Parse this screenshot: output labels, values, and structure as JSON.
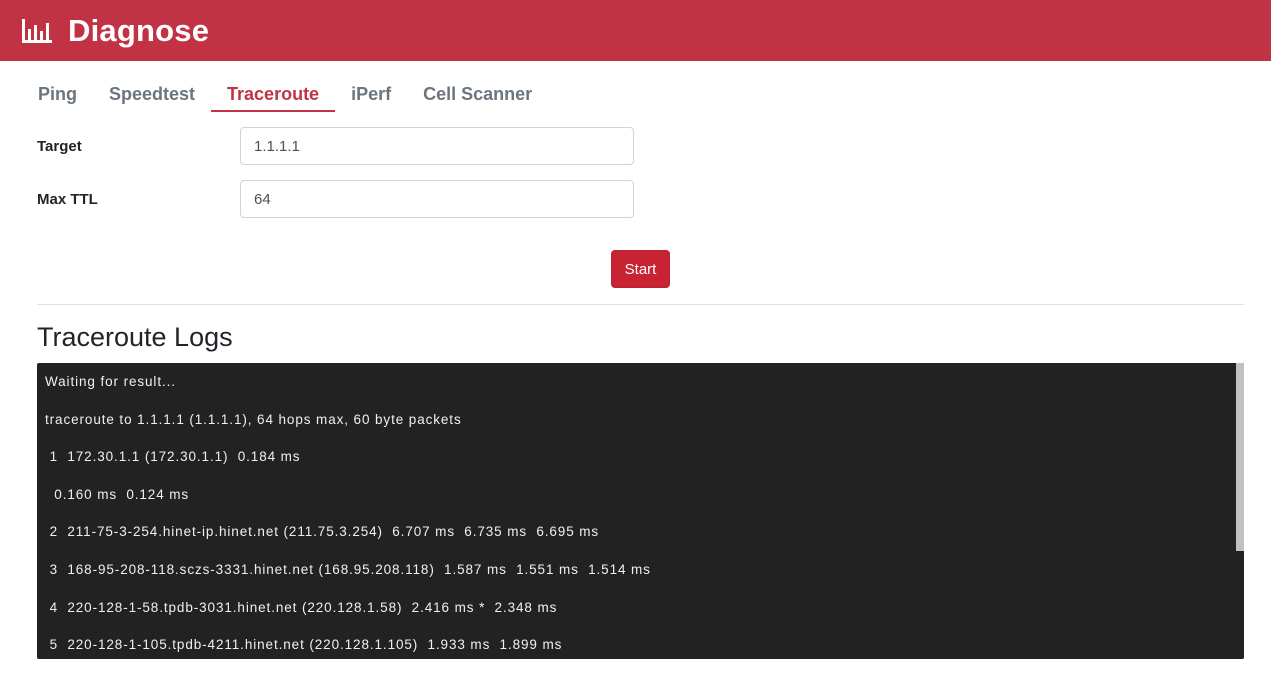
{
  "header": {
    "title": "Diagnose",
    "icon": "bar-chart-icon",
    "background": "#c13344"
  },
  "tabs": [
    {
      "label": "Ping",
      "active": false
    },
    {
      "label": "Speedtest",
      "active": false
    },
    {
      "label": "Traceroute",
      "active": true
    },
    {
      "label": "iPerf",
      "active": false
    },
    {
      "label": "Cell Scanner",
      "active": false
    }
  ],
  "form": {
    "target_label": "Target",
    "target_value": "1.1.1.1",
    "max_ttl_label": "Max TTL",
    "max_ttl_value": "64",
    "start_label": "Start"
  },
  "logs": {
    "title": "Traceroute Logs",
    "lines": [
      "Waiting for result...",
      "traceroute to 1.1.1.1 (1.1.1.1), 64 hops max, 60 byte packets",
      " 1  172.30.1.1 (172.30.1.1)  0.184 ms",
      "  0.160 ms  0.124 ms",
      " 2  211-75-3-254.hinet-ip.hinet.net (211.75.3.254)  6.707 ms  6.735 ms  6.695 ms",
      " 3  168-95-208-118.sczs-3331.hinet.net (168.95.208.118)  1.587 ms  1.551 ms  1.514 ms",
      " 4  220-128-1-58.tpdb-3031.hinet.net (220.128.1.58)  2.416 ms *  2.348 ms",
      " 5  220-128-1-105.tpdb-4211.hinet.net (220.128.1.105)  1.933 ms  1.899 ms"
    ]
  }
}
